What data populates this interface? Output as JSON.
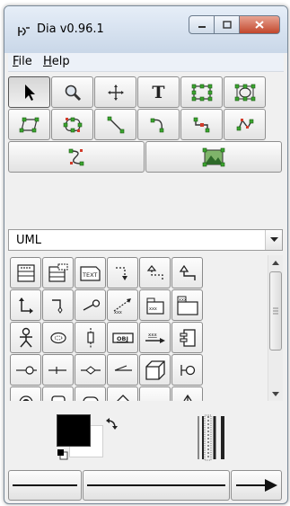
{
  "window": {
    "title": "Dia v0.96.1",
    "accent_titlebar": "#c9d7e8",
    "close_color": "#c2472c"
  },
  "menubar": {
    "items": [
      {
        "label_mnemonic": "F",
        "label_rest": "ile"
      },
      {
        "label_mnemonic": "H",
        "label_rest": "elp"
      }
    ]
  },
  "toolbox": {
    "tools": [
      [
        "pointer-icon",
        "magnify-icon",
        "scroll-icon",
        "text-icon",
        "box-icon",
        "ellipse-icon"
      ],
      [
        "polygon-icon",
        "beziergon-icon",
        "line-icon",
        "arc-icon",
        "zigzag-icon",
        "polyline-icon"
      ],
      [
        "bezier-icon",
        "image-icon"
      ]
    ],
    "text_glyph": "T"
  },
  "sheet": {
    "selected": "UML"
  },
  "shapes": {
    "labels": {
      "text": "TEXT",
      "obj": "OBJ",
      "xxx": "xxx",
      "template": "<<<>>>"
    }
  },
  "colors": {
    "foreground": "#000000",
    "background": "#ffffff"
  }
}
